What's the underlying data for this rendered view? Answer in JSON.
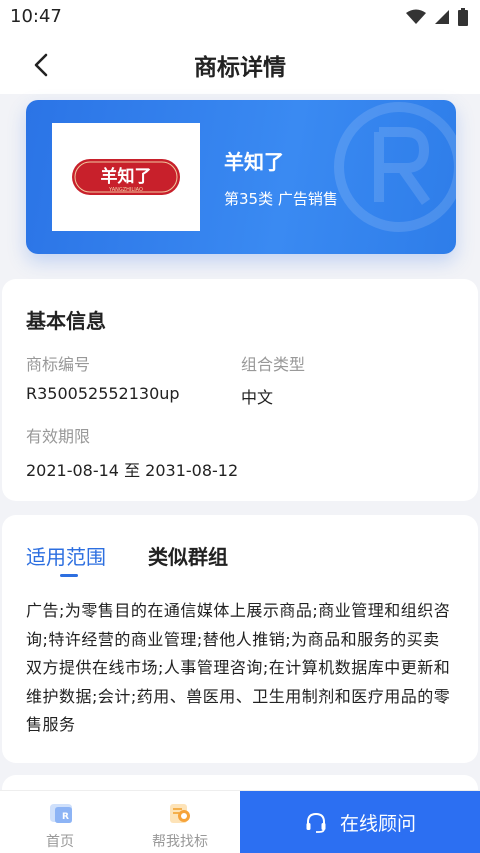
{
  "status_bar": {
    "time": "10:47"
  },
  "header": {
    "title": "商标详情"
  },
  "brand": {
    "logo_text": "羊知了",
    "logo_subtext": "YANGZHILIAO",
    "name": "羊知了",
    "class_info": "第35类 广告销售"
  },
  "basic_info": {
    "title": "基本信息",
    "fields": [
      {
        "label": "商标编号",
        "value": "R350052552130up"
      },
      {
        "label": "组合类型",
        "value": "中文"
      },
      {
        "label": "有效期限",
        "value": "2021-08-14 至 2031-08-12"
      }
    ]
  },
  "scope": {
    "tabs": [
      {
        "label": "适用范围"
      },
      {
        "label": "类似群组"
      }
    ],
    "text_lines": [
      "广告;为零售目的在通信媒体上展示商品;商业管理和组织咨",
      "询;特许经营的商业管理;替他人推销;为商品和服务的买卖",
      "双方提供在线市场;人事管理咨询;在计算机数据库中更新和",
      "维护数据;会计;药用、兽医用、卫生用制剂和医疗用品的零",
      "售服务"
    ]
  },
  "bottom_nav": {
    "home": "首页",
    "help": "帮我找标",
    "consult": "在线顾问"
  },
  "colors": {
    "accent": "#2c6ff2",
    "logo_red": "#c8202b"
  }
}
